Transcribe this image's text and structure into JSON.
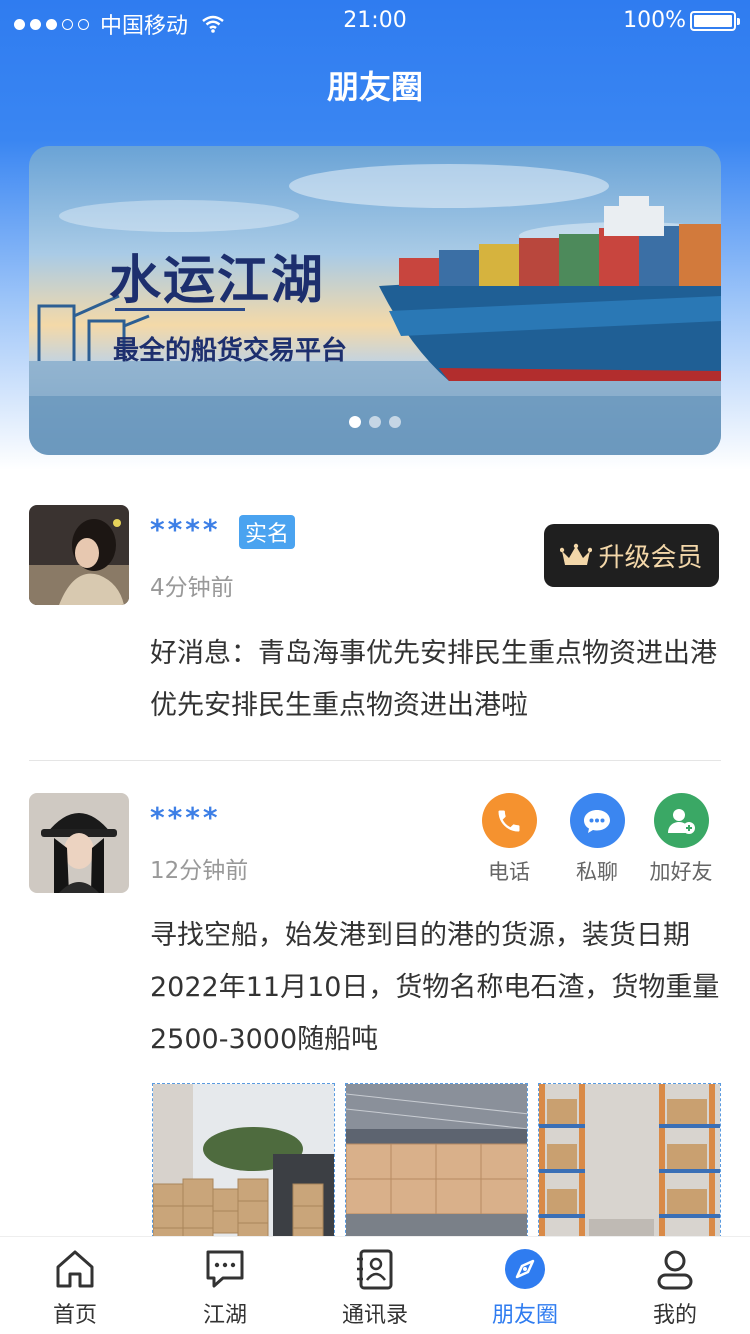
{
  "status_bar": {
    "carrier": "中国移动",
    "time": "21:00",
    "battery": "100%"
  },
  "header": {
    "title": "朋友圈"
  },
  "banner": {
    "title": "水运江湖",
    "subtitle": "最全的船货交易平台",
    "page_count": 3,
    "active_index": 0
  },
  "posts": [
    {
      "name": "****",
      "badge": "实名",
      "time": "4分钟前",
      "content": "好消息：青岛海事优先安排民生重点物资进出港优先安排民生重点物资进出港啦",
      "vip_label": "升级会员"
    },
    {
      "name": "****",
      "time": "12分钟前",
      "content": "寻找空船，始发港到目的港的货源，装货日期2022年11月10日，货物名称电石渣，货物重量2500-3000随船吨",
      "actions": [
        {
          "label": "电话",
          "icon": "phone-icon",
          "color": "#f5922f"
        },
        {
          "label": "私聊",
          "icon": "chat-icon",
          "color": "#3b86f0"
        },
        {
          "label": "加好友",
          "icon": "add-friend-icon",
          "color": "#3aa865"
        }
      ]
    }
  ],
  "tabbar": {
    "items": [
      {
        "label": "首页",
        "icon": "home-icon"
      },
      {
        "label": "江湖",
        "icon": "message-icon"
      },
      {
        "label": "通讯录",
        "icon": "contacts-icon"
      },
      {
        "label": "朋友圈",
        "icon": "compass-icon"
      },
      {
        "label": "我的",
        "icon": "user-icon"
      }
    ],
    "active_index": 3,
    "active_color": "#2f7cf0"
  }
}
